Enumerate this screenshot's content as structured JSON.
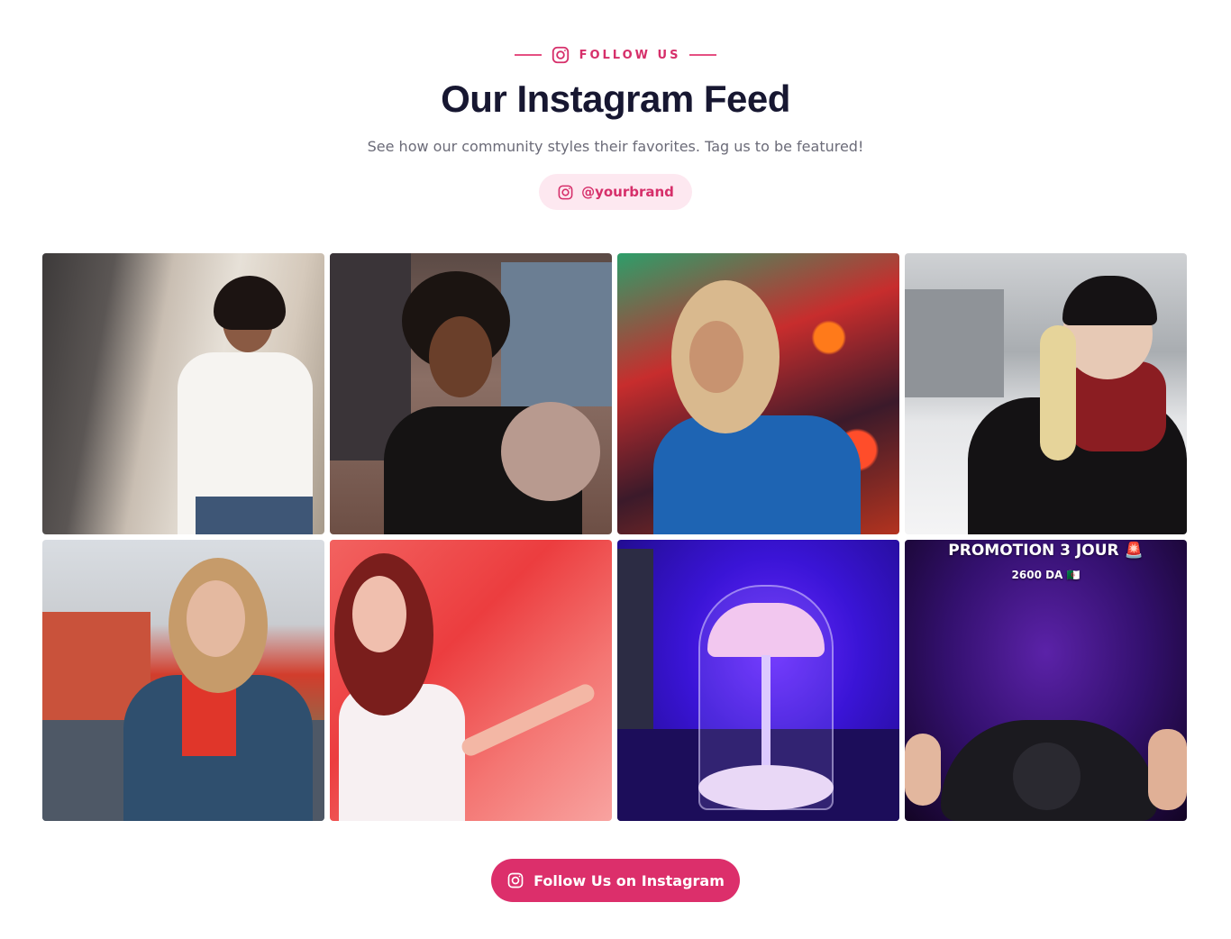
{
  "header": {
    "eyebrow": "FOLLOW US",
    "title": "Our Instagram Feed",
    "subtitle": "See how our community styles their favorites. Tag us to be featured!",
    "handle": "@yourbrand"
  },
  "posts": [
    {
      "alt": "",
      "overlay_title": "",
      "overlay_price": ""
    },
    {
      "alt": "",
      "overlay_title": "",
      "overlay_price": ""
    },
    {
      "alt": "",
      "overlay_title": "",
      "overlay_price": ""
    },
    {
      "alt": "",
      "overlay_title": "",
      "overlay_price": ""
    },
    {
      "alt": "",
      "overlay_title": "",
      "overlay_price": ""
    },
    {
      "alt": "",
      "overlay_title": "",
      "overlay_price": ""
    },
    {
      "alt": "",
      "overlay_title": "",
      "overlay_price": ""
    },
    {
      "alt": "",
      "overlay_title": "PROMOTION 3 JOUR 🚨",
      "overlay_price": "2600 DA 🇩🇿"
    }
  ],
  "cta": {
    "label": "Follow Us on Instagram"
  },
  "colors": {
    "accent": "#dc2f6b",
    "accent_soft": "#fde8f0",
    "title": "#171731",
    "muted": "#6b6b78"
  },
  "icons": {
    "brand": "instagram-icon"
  }
}
